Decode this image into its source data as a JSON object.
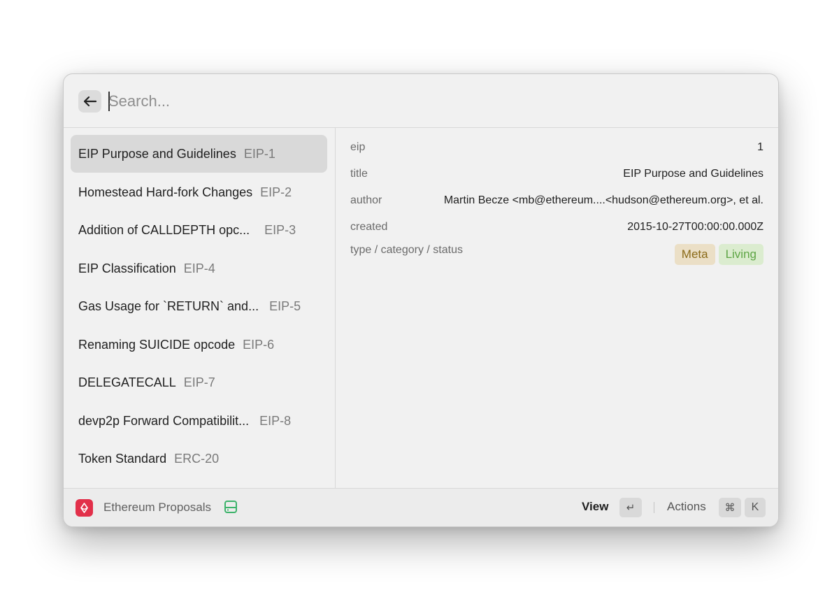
{
  "search": {
    "placeholder": "Search...",
    "back_icon": "arrow-left-icon"
  },
  "list": {
    "items": [
      {
        "title": "EIP Purpose and Guidelines",
        "subtitle": "EIP-1",
        "selected": true
      },
      {
        "title": "Homestead Hard-fork Changes",
        "subtitle": "EIP-2"
      },
      {
        "title": "Addition of CALLDEPTH opc...",
        "subtitle": "EIP-3"
      },
      {
        "title": "EIP Classification",
        "subtitle": "EIP-4"
      },
      {
        "title": "Gas Usage for `RETURN` and...",
        "subtitle": "EIP-5"
      },
      {
        "title": "Renaming SUICIDE opcode",
        "subtitle": "EIP-6"
      },
      {
        "title": "DELEGATECALL",
        "subtitle": "EIP-7"
      },
      {
        "title": "devp2p Forward Compatibilit...",
        "subtitle": "EIP-8"
      },
      {
        "title": "Token Standard",
        "subtitle": "ERC-20"
      }
    ]
  },
  "detail": {
    "eip_label": "eip",
    "eip_value": "1",
    "title_label": "title",
    "title_value": "EIP Purpose and Guidelines",
    "author_label": "author",
    "author_value": "Martin Becze <mb@ethereum....<hudson@ethereum.org>, et al.",
    "created_label": "created",
    "created_value": "2015-10-27T00:00:00.000Z",
    "type_label": "type / category / status",
    "tags": [
      "Meta",
      "Living"
    ],
    "tag_colors": {
      "Meta": "#8a6a18",
      "Living": "#5ea545"
    }
  },
  "footer": {
    "app_icon": "ethereum-app-icon",
    "app_name": "Ethereum Proposals",
    "storage_icon": "hard-drive-icon",
    "view_label": "View",
    "view_key": "↵",
    "actions_label": "Actions",
    "actions_keys": [
      "⌘",
      "K"
    ]
  },
  "colors": {
    "accent_app_icon": "#e2304a",
    "storage_icon": "#3db36b"
  }
}
